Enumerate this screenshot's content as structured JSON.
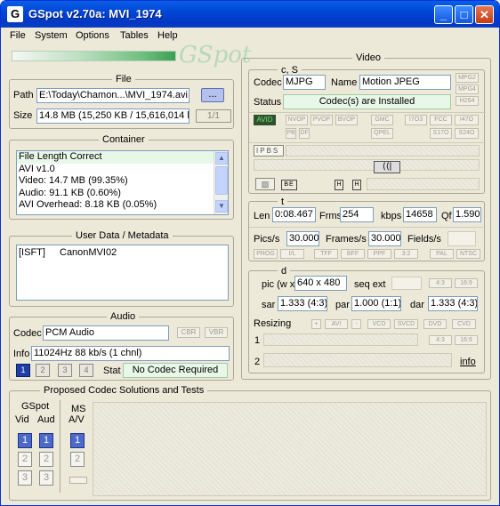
{
  "window": {
    "title": "GSpot v2.70a: MVI_1974",
    "icon_glyph": "G",
    "minimize": "_",
    "maximize": "□",
    "close": "✕"
  },
  "menu": [
    "File",
    "System",
    "Options",
    "Tables",
    "Help"
  ],
  "logo_text": "GSpot",
  "file": {
    "title": "File",
    "path_label": "Path",
    "path_value": "E:\\Today\\Chamon...\\MVI_1974.avi",
    "browse_label": "...",
    "size_label": "Size",
    "size_value": "14.8 MB (15,250 KB / 15,616,014 b",
    "part": "1/1"
  },
  "container": {
    "title": "Container",
    "lines": [
      "File Length Correct",
      "AVI v1.0",
      "Video: 14.7 MB (99.35%)",
      "Audio: 91.1 KB (0.60%)",
      "AVI Overhead: 8.18 KB (0.05%)"
    ]
  },
  "userdata": {
    "title": "User Data / Metadata",
    "key": "[ISFT]",
    "value": "CanonMVI02"
  },
  "audio": {
    "title": "Audio",
    "codec_label": "Codec",
    "codec_value": "PCM Audio",
    "cbr": "CBR",
    "vbr": "VBR",
    "info_label": "Info",
    "info_value": "11024Hz  88 kb/s (1 chnl)",
    "streams": [
      "1",
      "2",
      "3",
      "4"
    ],
    "stat_label": "Stat",
    "stat_value": "No Codec Required"
  },
  "proposed": {
    "title": "Proposed Codec Solutions and Tests",
    "gspot_label": "GSpot",
    "vid_label": "Vid",
    "aud_label": "Aud",
    "ms_label": "MS",
    "av_label": "A/V",
    "buttons": [
      "1",
      "2",
      "3"
    ]
  },
  "video": {
    "title": "Video",
    "cs_label": "c, S",
    "codec_label": "Codec",
    "codec_value": "MJPG",
    "name_label": "Name",
    "name_value": "Motion JPEG",
    "fmt_buttons": [
      "MPG2",
      "MPG4",
      "H264"
    ],
    "status_label": "Status",
    "status_value": "Codec(s) are Installed",
    "avid": "AVID",
    "flag_buttons": [
      "NVOP",
      "PVOP",
      "BVOP",
      "GMC",
      "I7O3",
      "FCC",
      "I47O"
    ],
    "flag_buttons2": [
      "PB",
      "DF",
      "QPEL",
      "S17O",
      "S24O"
    ],
    "frame_types": [
      "I",
      "P",
      "B",
      "S"
    ],
    "timeline_markers": [
      "B",
      "E",
      "H",
      "H"
    ],
    "t_label": "t",
    "len_label": "Len",
    "len_value": "0:08.467",
    "frms_label": "Frms",
    "frms_value": "254",
    "kbps_label": "kbps",
    "kbps_value": "14658",
    "qf_label": "Qf",
    "qf_value": "1.590",
    "pics_label": "Pics/s",
    "pics_value": "30.000",
    "frames_label": "Frames/s",
    "frames_value": "30.000",
    "fields_label": "Fields/s",
    "pulldown": [
      "PROG",
      "I/L",
      "TFF",
      "BFF",
      "PPF",
      "3:2",
      "PAL",
      "NTSC"
    ],
    "d_label": "d",
    "pic_label": "pic (w x",
    "pic_value": "640 x 480",
    "seq_label": "seq ext",
    "ar_buttons": [
      "4:3",
      "16:9"
    ],
    "sar_label": "sar",
    "sar_value": "1.333 (4:3)",
    "par_label": "par",
    "par_value": "1.000 (1:1)",
    "dar_label": "dar",
    "dar_value": "1.333 (4:3)",
    "resizing_label": "Resizing",
    "resize_buttons": [
      "+",
      "AVI",
      "-",
      "VCD",
      "SVCD",
      "DVD",
      "CVD"
    ],
    "row1": "1",
    "row2": "2",
    "ar_buttons2": [
      "4:3",
      "16:9"
    ],
    "info_link": "info"
  }
}
